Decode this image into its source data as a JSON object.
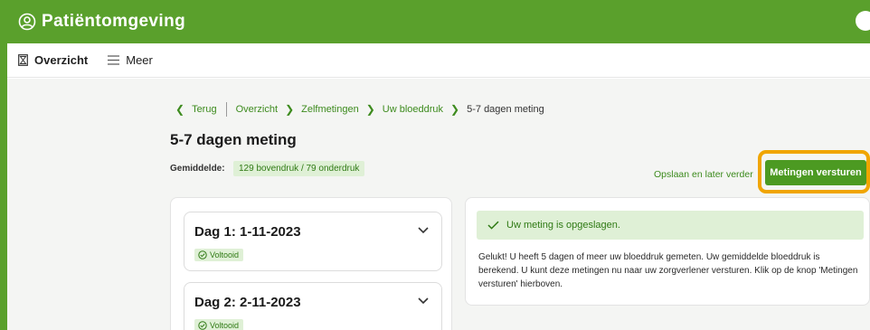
{
  "header": {
    "title": "Patiëntomgeving"
  },
  "subnav": {
    "overview_label": "Overzicht",
    "more_label": "Meer"
  },
  "breadcrumb": {
    "back": "Terug",
    "items": [
      "Overzicht",
      "Zelfmetingen",
      "Uw bloeddruk"
    ],
    "current": "5-7 dagen meting"
  },
  "page": {
    "title": "5-7 dagen meting",
    "average_label": "Gemiddelde:",
    "average_value": "129 bovendruk / 79 onderdruk",
    "save_later": "Opslaan en later verder",
    "submit": "Metingen versturen"
  },
  "days": [
    {
      "title": "Dag 1: 1-11-2023",
      "status": "Voltooid"
    },
    {
      "title": "Dag 2: 2-11-2023",
      "status": "Voltooid"
    }
  ],
  "notice": {
    "alert": "Uw meting is opgeslagen.",
    "text": "Gelukt! U heeft 5 dagen of meer uw bloeddruk gemeten. Uw gemiddelde bloeddruk is berekend. U kunt deze metingen nu naar uw zorgverlener versturen. Klik op de knop 'Metingen versturen' hierboven."
  },
  "colors": {
    "brand_green": "#5aa02c",
    "button_green": "#4c9a22",
    "highlight_orange": "#f0a500",
    "badge_bg": "#dff0d6"
  }
}
